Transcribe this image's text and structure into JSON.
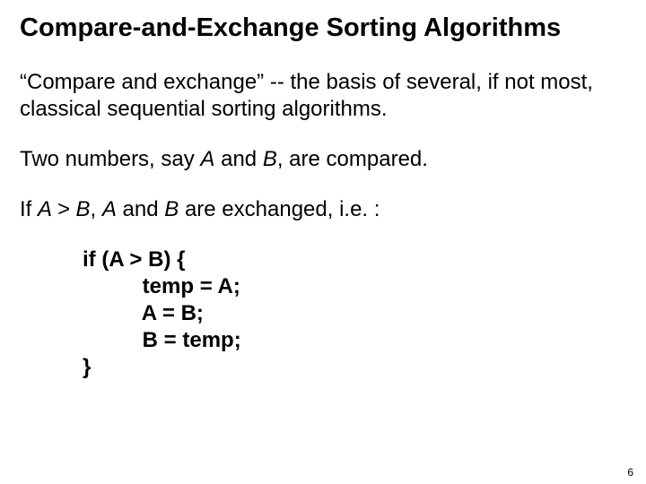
{
  "title": "Compare-and-Exchange Sorting Algorithms",
  "p1a": "“Compare and exchange”  -- the basis of several, if not most, classical sequential sorting algorithms.",
  "p2_pre": "Two numbers, say ",
  "p2_a": "A",
  "p2_mid": " and ",
  "p2_b": "B",
  "p2_post": ", are compared.",
  "p3_pre": "If ",
  "p3_a": "A",
  "p3_gt": " > ",
  "p3_b": "B",
  "p3_comma": ", ",
  "p3_a2": "A",
  "p3_and": " and ",
  "p3_b2": "B",
  "p3_post": " are exchanged, i.e. :",
  "code": "if (A > B) {\n          temp = A;\n          A = B;\n          B = temp;\n}",
  "pagenum": "6"
}
